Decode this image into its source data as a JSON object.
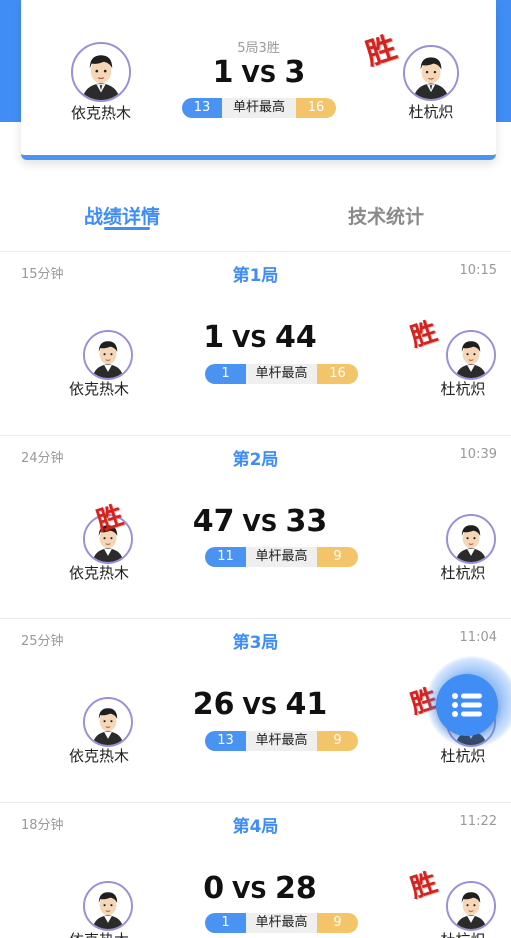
{
  "summary": {
    "format": "5局3胜",
    "left_player": "依克热木",
    "right_player": "杜杭炽",
    "left_score": "1",
    "vs": "VS",
    "right_score": "3",
    "left_break": "13",
    "break_label": "单杆最高",
    "right_break": "16",
    "winner_stamp": "胜"
  },
  "tabs": {
    "records": "战绩详情",
    "stats": "技术统计"
  },
  "games": [
    {
      "title": "第1局",
      "duration": "15分钟",
      "time": "10:15",
      "left_player": "依克热木",
      "right_player": "杜杭炽",
      "left_score": "1",
      "vs": "VS",
      "right_score": "44",
      "left_break": "1",
      "break_label": "单杆最高",
      "right_break": "16",
      "stamp": "胜"
    },
    {
      "title": "第2局",
      "duration": "24分钟",
      "time": "10:39",
      "left_player": "依克热木",
      "right_player": "杜杭炽",
      "left_score": "47",
      "vs": "VS",
      "right_score": "33",
      "left_break": "11",
      "break_label": "单杆最高",
      "right_break": "9",
      "stamp": "胜"
    },
    {
      "title": "第3局",
      "duration": "25分钟",
      "time": "11:04",
      "left_player": "依克热木",
      "right_player": "杜杭炽",
      "left_score": "26",
      "vs": "VS",
      "right_score": "41",
      "left_break": "13",
      "break_label": "单杆最高",
      "right_break": "9",
      "stamp": "胜"
    },
    {
      "title": "第4局",
      "duration": "18分钟",
      "time": "11:22",
      "left_player": "依克热木",
      "right_player": "杜杭炽",
      "left_score": "0",
      "vs": "VS",
      "right_score": "28",
      "left_break": "1",
      "break_label": "单杆最高",
      "right_break": "9",
      "stamp": "胜"
    }
  ],
  "colors": {
    "accent_blue": "#3f8df5",
    "break_yellow": "#f4c46a",
    "winner_red": "#d2231e"
  },
  "icons": {
    "avatar": "cartoon-man-avatar",
    "fab": "list-menu-icon"
  }
}
